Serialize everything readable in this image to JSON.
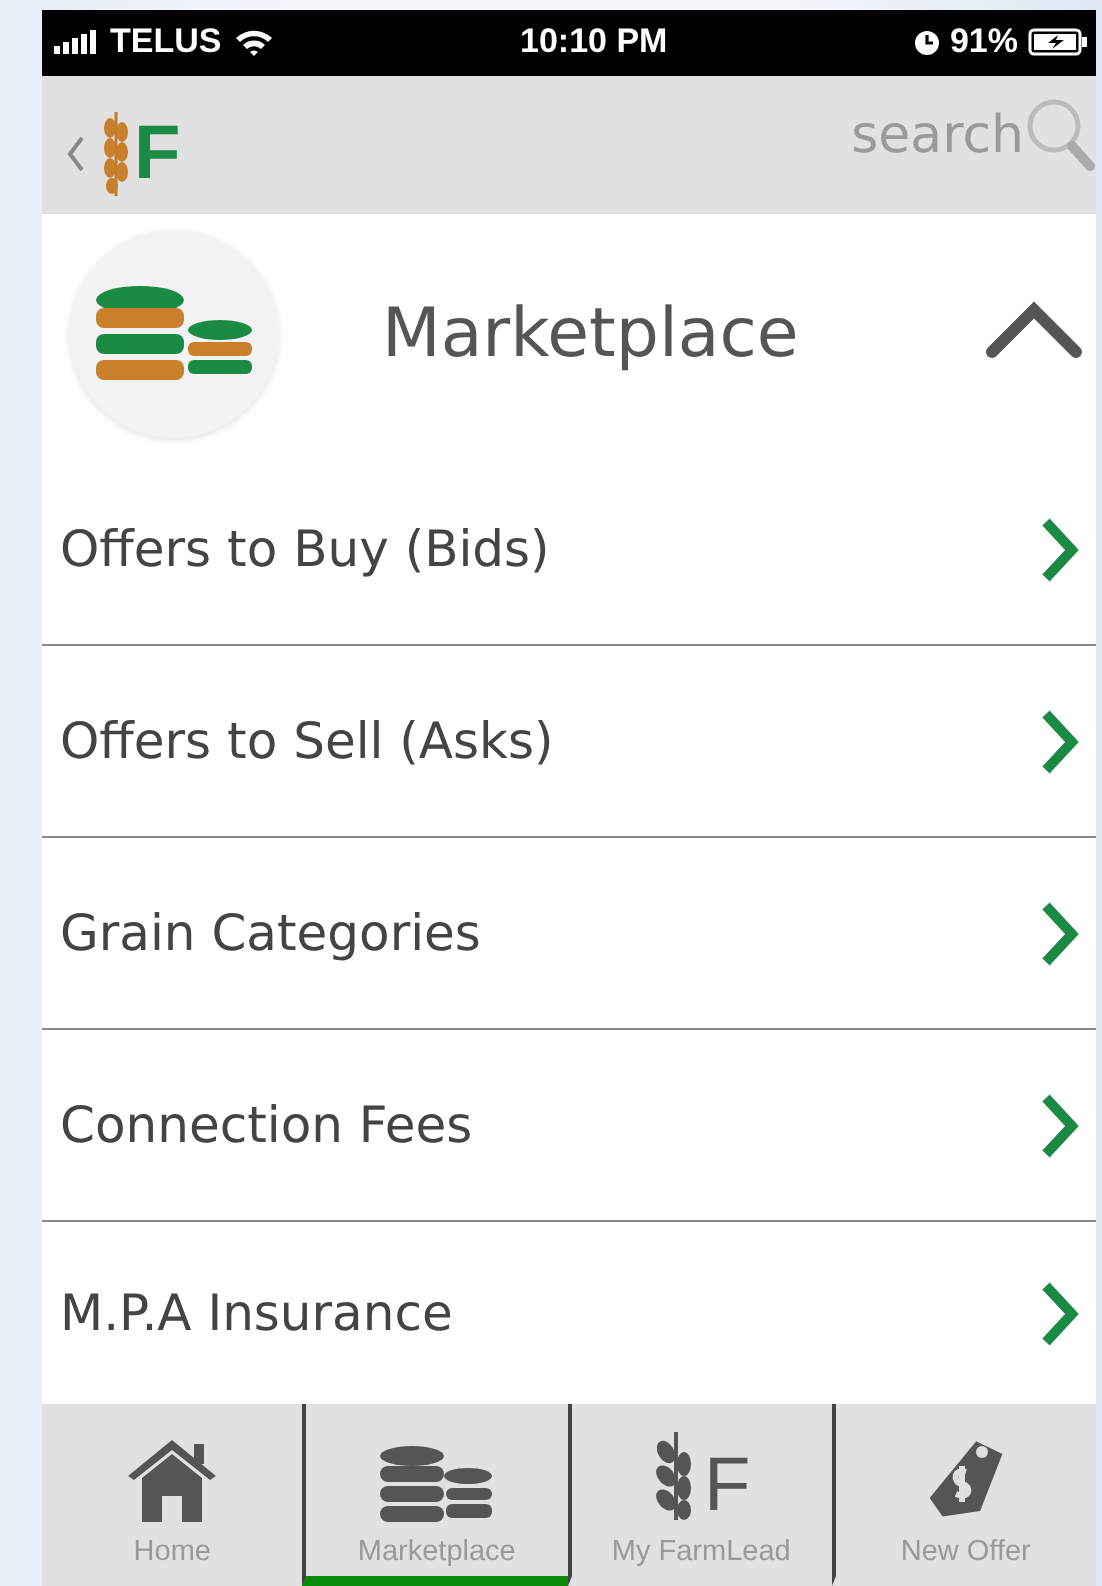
{
  "status_bar": {
    "carrier": "TELUS",
    "time": "10:10 PM",
    "battery": "91%"
  },
  "header": {
    "logo_letter": "F",
    "search_placeholder": "search"
  },
  "section": {
    "title": "Marketplace",
    "expanded": true
  },
  "items": [
    {
      "label": "Offers to Buy (Bids)"
    },
    {
      "label": "Offers to Sell (Asks)"
    },
    {
      "label": "Grain Categories"
    },
    {
      "label": "Connection Fees"
    },
    {
      "label": "M.P.A Insurance"
    }
  ],
  "tabs": [
    {
      "label": "Home",
      "kind": "home",
      "selected": false
    },
    {
      "label": "Marketplace",
      "kind": "coins",
      "selected": true
    },
    {
      "label": "My FarmLead",
      "kind": "wheat",
      "letter": "F",
      "selected": false
    },
    {
      "label": "New Offer",
      "kind": "tag",
      "selected": false
    }
  ]
}
